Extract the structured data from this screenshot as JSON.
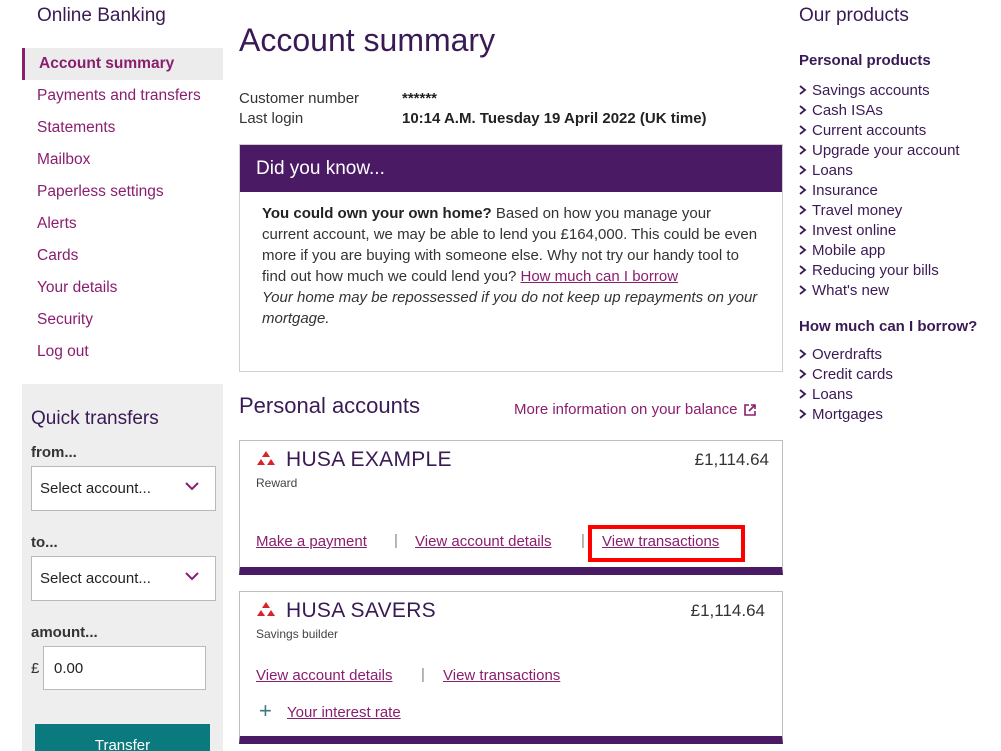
{
  "sidebar": {
    "title": "Online Banking",
    "items": [
      {
        "label": "Account summary"
      },
      {
        "label": "Payments and transfers"
      },
      {
        "label": "Statements"
      },
      {
        "label": "Mailbox"
      },
      {
        "label": "Paperless settings"
      },
      {
        "label": "Alerts"
      },
      {
        "label": "Cards"
      },
      {
        "label": "Your details"
      },
      {
        "label": "Security"
      },
      {
        "label": "Log out"
      }
    ]
  },
  "quick_transfers": {
    "title": "Quick transfers",
    "from_label": "from...",
    "from_value": "Select account...",
    "to_label": "to...",
    "to_value": "Select account...",
    "amount_label": "amount...",
    "currency": "£",
    "amount_value": "0.00",
    "button_label": "Transfer"
  },
  "main": {
    "title": "Account summary",
    "customer_number_label": "Customer number",
    "customer_number_value": "******",
    "last_login_label": "Last login",
    "last_login_value": "10:14 A.M. Tuesday 19 April 2022 (UK time)",
    "did_you_know": {
      "heading": "Did you know...",
      "bold": "You could own your own home?",
      "text": " Based on how you manage your current account, we may be able to lend you £164,000. This could be even more if you are buying with someone else. Why not try our handy tool to find out how much we could lend you? ",
      "link": "How much can I borrow",
      "disclaimer": "Your home may be repossessed if you do not keep up repayments on your mortgage."
    },
    "personal_accounts_title": "Personal accounts",
    "more_info_link": "More information on your balance",
    "accounts": [
      {
        "name": "HUSA EXAMPLE",
        "type": "Reward",
        "balance": "£1,114.64",
        "link_payment": "Make a payment",
        "link_details": "View account details",
        "link_transactions": "View transactions"
      },
      {
        "name": "HUSA SAVERS",
        "type": "Savings builder",
        "balance": "£1,114.64",
        "link_details": "View account details",
        "link_transactions": "View transactions",
        "link_interest": "Your interest rate"
      }
    ]
  },
  "products": {
    "title": "Our products",
    "personal_title": "Personal products",
    "personal_items": [
      "Savings accounts",
      "Cash ISAs",
      "Current accounts",
      "Upgrade your account",
      "Loans",
      "Insurance",
      "Travel money",
      "Invest online",
      "Mobile app",
      "Reducing your bills",
      "What's new"
    ],
    "borrow_title": "How much can I borrow?",
    "borrow_items": [
      "Overdrafts",
      "Credit cards",
      "Loans",
      "Mortgages"
    ]
  },
  "colors": {
    "brand_purple": "#4b1a64",
    "link_magenta": "#8a1e6e",
    "teal_button": "#0a7a7e",
    "highlight_red": "#ff0000",
    "logo_red": "#d8232a"
  }
}
